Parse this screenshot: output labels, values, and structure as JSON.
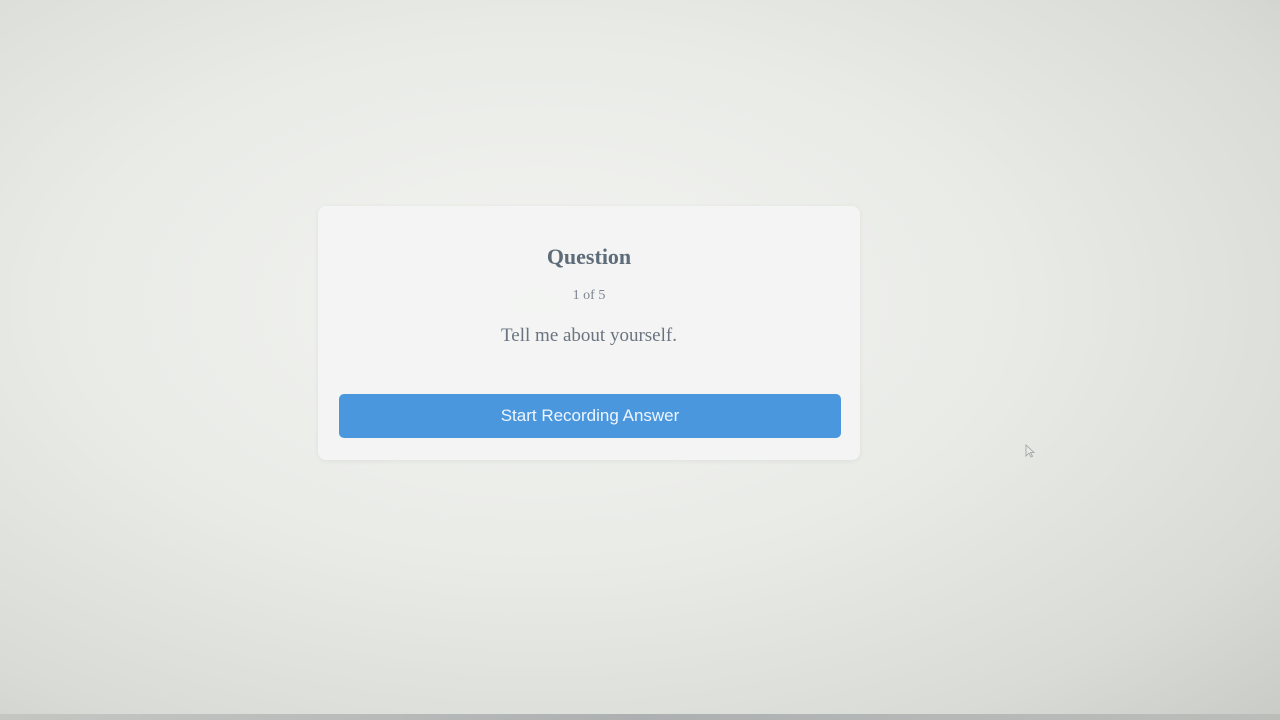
{
  "question_card": {
    "title": "Question",
    "counter": "1 of 5",
    "question_text": "Tell me about yourself.",
    "record_button_label": "Start Recording Answer"
  },
  "colors": {
    "accent": "#4a97de",
    "title_text": "#5e6b78",
    "body_text": "#6a7480"
  },
  "icons": {
    "cursor": "mouse-pointer-icon"
  }
}
